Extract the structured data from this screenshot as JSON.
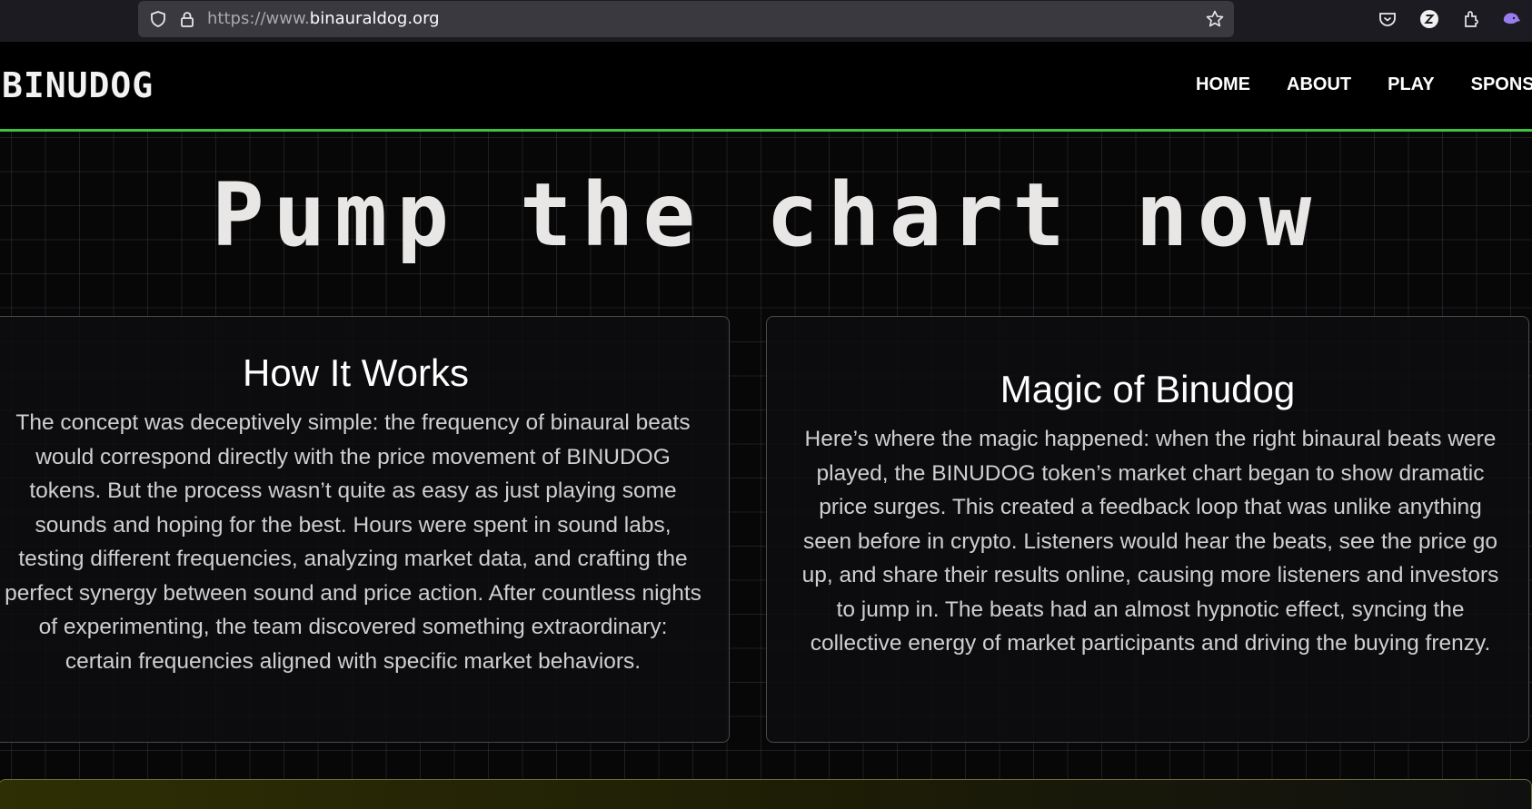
{
  "browser": {
    "url_prefix": "https://www.",
    "url_domain": "binauraldog.org"
  },
  "header": {
    "logo": "BINUDOG",
    "nav": [
      "HOME",
      "ABOUT",
      "PLAY",
      "SPONS"
    ]
  },
  "hero": {
    "title": "Pump the chart now"
  },
  "cards": [
    {
      "title": "How It Works",
      "body": "The concept was deceptively simple: the frequency of binaural beats would correspond directly with the price movement of BINUDOG tokens. But the process wasn’t quite as easy as just playing some sounds and hoping for the best. Hours were spent in sound labs, testing different frequencies, analyzing market data, and crafting the perfect synergy between sound and price action. After countless nights of experimenting, the team discovered something extraordinary: certain frequencies aligned with specific market behaviors."
    },
    {
      "title": "Magic of Binudog",
      "body": "Here’s where the magic happened: when the right binaural beats were played, the BINUDOG token’s market chart began to show dramatic price surges. This created a feedback loop that was unlike anything seen before in crypto. Listeners would hear the beats, see the price go up, and share their results online, causing more listeners and investors to jump in. The beats had an almost hypnotic effect, syncing the collective energy of market participants and driving the buying frenzy."
    }
  ],
  "colors": {
    "accent_line": "#3ec33e",
    "background": "#070707",
    "banner": "#2f2f05"
  },
  "icons": [
    "shield-icon",
    "lock-icon",
    "star-icon",
    "pocket-icon",
    "account-icon",
    "extensions-icon",
    "app-menu-icon"
  ]
}
